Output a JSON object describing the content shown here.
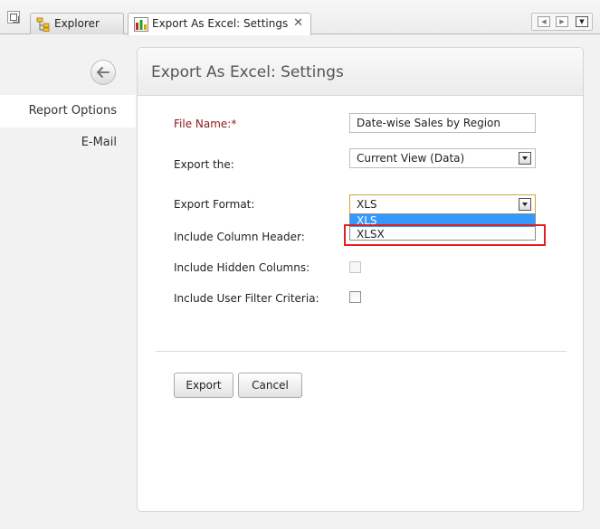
{
  "tabs": [
    {
      "label": "Explorer",
      "icon": "explorer-icon",
      "active": false
    },
    {
      "label": "Export As Excel: Settings",
      "icon": "excel-chart-icon",
      "active": true
    }
  ],
  "tab_close_glyph": "✕",
  "nav": {
    "prev_icon": "arrow-left-icon",
    "next_icon": "arrow-right-icon",
    "menu_icon": "chevron-down-icon"
  },
  "sidebar": {
    "back_icon": "back-arrow-icon",
    "items": [
      {
        "label": "Report Options",
        "active": true
      },
      {
        "label": "E-Mail",
        "active": false
      }
    ]
  },
  "panel": {
    "title": "Export As Excel: Settings",
    "fields": {
      "file_name": {
        "label": "File Name:*",
        "value": "Date-wise Sales by Region"
      },
      "export_the": {
        "label": "Export the:",
        "value": "Current View (Data)"
      },
      "export_format": {
        "label": "Export Format:",
        "value": "XLS",
        "options": [
          "XLS",
          "XLSX"
        ],
        "highlighted_option": "XLS"
      },
      "include_column_header": {
        "label": "Include Column Header:"
      },
      "include_hidden_columns": {
        "label": "Include Hidden Columns:",
        "checked": false,
        "disabled": true
      },
      "include_user_filter_criteria": {
        "label": "Include User Filter Criteria:",
        "checked": false
      }
    },
    "buttons": {
      "export": "Export",
      "cancel": "Cancel"
    }
  },
  "colors": {
    "required_label": "#8a1a1a",
    "selected_option": "#3399ff",
    "highlight_box": "#e02020",
    "focus_border": "#d7a33a"
  }
}
